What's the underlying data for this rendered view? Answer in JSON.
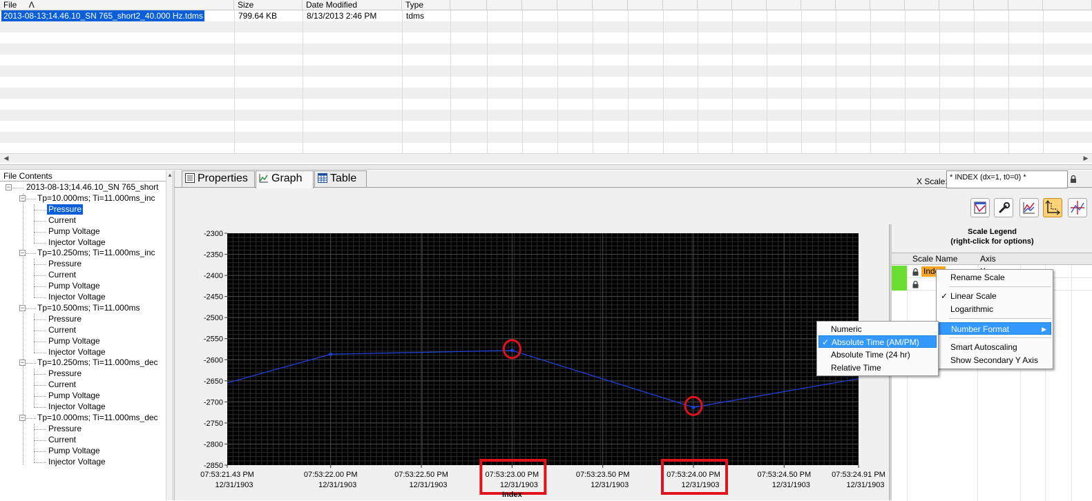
{
  "file_list": {
    "headers": [
      "File",
      "Size",
      "Date Modified",
      "Type"
    ],
    "sort_indicator": "Λ",
    "rows": [
      {
        "name": "2013-08-13;14.46.10_SN 765_short2_40.000 Hz.tdms",
        "size": "799.64 KB",
        "modified": "8/13/2013 2:46 PM",
        "type": "tdms"
      }
    ]
  },
  "tree": {
    "header": "File Contents",
    "root": "2013-08-13;14.46.10_SN 765_short",
    "groups": [
      {
        "label": "Tp=10.000ms; Ti=11.000ms_inc",
        "channels": [
          "Pressure",
          "Current",
          "Pump Voltage",
          "Injector Voltage"
        ]
      },
      {
        "label": "Tp=10.250ms; Ti=11.000ms_inc",
        "channels": [
          "Pressure",
          "Current",
          "Pump Voltage",
          "Injector Voltage"
        ]
      },
      {
        "label": "Tp=10.500ms; Ti=11.000ms",
        "channels": [
          "Pressure",
          "Current",
          "Pump Voltage",
          "Injector Voltage"
        ]
      },
      {
        "label": "Tp=10.250ms; Ti=11.000ms_dec",
        "channels": [
          "Pressure",
          "Current",
          "Pump Voltage",
          "Injector Voltage"
        ]
      },
      {
        "label": "Tp=10.000ms; Ti=11.000ms_dec",
        "channels": [
          "Pressure",
          "Current",
          "Pump Voltage",
          "Injector Voltage"
        ]
      }
    ],
    "selected": "Pressure"
  },
  "tabs": [
    {
      "label": "Properties",
      "icon": "properties-icon"
    },
    {
      "label": "Graph",
      "icon": "graph-icon"
    },
    {
      "label": "Table",
      "icon": "table-icon"
    }
  ],
  "active_tab": "Graph",
  "x_scale": {
    "label": "X Scale:",
    "value": "* INDEX (dx=1, t0=0) *"
  },
  "toolbar": [
    "plot-properties-icon",
    "wrench-icon",
    "chart-type-icon",
    "scale-icon",
    "cursor-icon"
  ],
  "legend": {
    "title": "Scale Legend",
    "subtitle": "(right-click for options)",
    "headers": [
      "Scale Name",
      "Axis"
    ],
    "rows": [
      {
        "name": "Index",
        "axis": "X"
      },
      {
        "name": "",
        "axis": ""
      }
    ]
  },
  "scale_menu": {
    "items": [
      "Rename Scale",
      "Linear Scale",
      "Logarithmic",
      "Number Format",
      "Smart Autoscaling",
      "Show Secondary Y Axis"
    ],
    "checked": "Linear Scale",
    "highlighted": "Number Format"
  },
  "number_format_menu": {
    "items": [
      "Numeric",
      "Absolute Time (AM/PM)",
      "Absolute Time (24 hr)",
      "Relative Time"
    ],
    "checked": "Absolute Time (AM/PM)"
  },
  "colors": {
    "plot_bg": "#000000",
    "grid": "#4a4a4a",
    "line": "#1f3fd6",
    "highlight": "#e2121d",
    "selection": "#0a5ed7",
    "menu_highlight": "#3399ff"
  },
  "chart_data": {
    "type": "line",
    "xlabel": "Index",
    "ylabel": "",
    "ylim": [
      -2850,
      -2300
    ],
    "y_ticks": [
      "-2300",
      "-2350",
      "-2400",
      "-2450",
      "-2500",
      "-2550",
      "-2600",
      "-2650",
      "-2700",
      "-2750",
      "-2800",
      "-2850"
    ],
    "x_ticks": [
      {
        "time": "07:53:21.43 PM",
        "date": "12/31/1903"
      },
      {
        "time": "07:53:22.00 PM",
        "date": "12/31/1903"
      },
      {
        "time": "07:53:22.50 PM",
        "date": "12/31/1903"
      },
      {
        "time": "07:53:23.00 PM",
        "date": "12/31/1903"
      },
      {
        "time": "07:53:23.50 PM",
        "date": "12/31/1903"
      },
      {
        "time": "07:53:24.00 PM",
        "date": "12/31/1903"
      },
      {
        "time": "07:53:24.50 PM",
        "date": "12/31/1903"
      },
      {
        "time": "07:53:24.91 PM",
        "date": "12/31/1903"
      }
    ],
    "x_tick_seconds": [
      21.43,
      22.0,
      22.5,
      23.0,
      23.5,
      24.0,
      24.5,
      24.91
    ],
    "xlim_seconds": [
      21.43,
      24.91
    ],
    "series": [
      {
        "x_seconds": [
          21.43,
          22.0,
          23.0,
          24.0,
          24.91
        ],
        "values": [
          -2655,
          -2587,
          -2578,
          -2713,
          -2645
        ]
      }
    ],
    "circled_points": [
      23.0,
      24.0
    ],
    "boxed_ticks": [
      3,
      5
    ]
  }
}
